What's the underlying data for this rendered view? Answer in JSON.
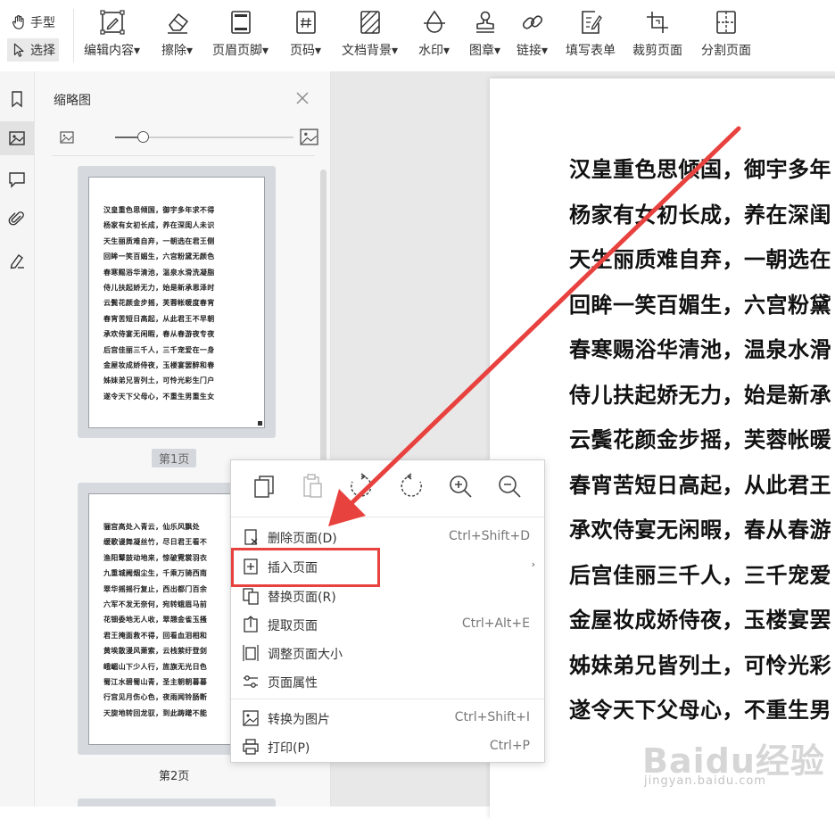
{
  "toolbar": {
    "hand_label": "手型",
    "select_label": "选择",
    "tools": [
      {
        "label": "编辑内容",
        "icon": "edit-content-icon"
      },
      {
        "label": "擦除",
        "icon": "eraser-icon"
      },
      {
        "label": "页眉页脚",
        "icon": "header-footer-icon"
      },
      {
        "label": "页码",
        "icon": "page-number-icon"
      },
      {
        "label": "文档背景",
        "icon": "document-background-icon"
      },
      {
        "label": "水印",
        "icon": "watermark-icon"
      },
      {
        "label": "图章",
        "icon": "stamp-icon"
      },
      {
        "label": "链接",
        "icon": "link-icon"
      },
      {
        "label": "填写表单",
        "icon": "fill-form-icon"
      },
      {
        "label": "裁剪页面",
        "icon": "crop-page-icon"
      },
      {
        "label": "分割页面",
        "icon": "split-page-icon"
      }
    ],
    "dropdown_marker": "▾"
  },
  "rail": {
    "icons": [
      "bookmark-icon",
      "thumbnail-icon",
      "comment-icon",
      "attachment-icon",
      "signature-icon"
    ],
    "active_index": 1
  },
  "thumbnails": {
    "title": "缩略图",
    "zoom_level": 0.16,
    "page1_label": "第1页",
    "page2_label": "第2页",
    "page1_lines": [
      "汉皇重色思倾国，御宇多年求不得",
      "杨家有女初长成，养在深闺人未识",
      "天生丽质难自弃，一朝选在君王侧",
      "回眸一笑百媚生，六宫粉黛无颜色",
      "春寒赐浴华清池，温泉水滑洗凝脂",
      "侍儿扶起娇无力，始是新承恩泽时",
      "云鬓花颜金步摇，芙蓉帐暖度春宵",
      "春宵苦短日高起，从此君王不早朝",
      "承欢侍宴无闲暇，春从春游夜专夜",
      "后宫佳丽三千人，三千宠爱在一身",
      "金屋妆成娇侍夜，玉楼宴罢醉和春",
      "姊妹弟兄皆列土，可怜光彩生门户",
      "遂令天下父母心，不重生男重生女"
    ],
    "page2_lines": [
      "骊宫高处入青云，仙乐风飘处",
      "缓歌谩舞凝丝竹，尽日君王看不",
      "渔阳鼙鼓动地来，惊破霓裳羽衣",
      "九重城阙烟尘生，千乘万骑西南",
      "翠华摇摇行复止，西出都门百余",
      "六军不发无奈何，宛转蛾眉马前",
      "花钿委地无人收，翠翘金雀玉搔",
      "君王掩面救不得，回看血泪相和",
      "黄埃散漫风萧索，云栈萦纡登剑",
      "峨嵋山下少人行，旌旗无光日色",
      "蜀江水碧蜀山青，圣主朝朝暮暮",
      "行宫见月伤心色，夜雨闻铃肠断",
      "天旋地转回龙驭，到此踌躇不能"
    ]
  },
  "document": {
    "lines": [
      "汉皇重色思倾国，御宇多年",
      "杨家有女初长成，养在深闺",
      "天生丽质难自弃，一朝选在",
      "回眸一笑百媚生，六宫粉黛",
      "春寒赐浴华清池，温泉水滑",
      "侍儿扶起娇无力，始是新承",
      "云鬓花颜金步摇，芙蓉帐暖",
      "春宵苦短日高起，从此君王",
      "承欢侍宴无闲暇，春从春游",
      "后宫佳丽三千人，三千宠爱",
      "金屋妆成娇侍夜，玉楼宴罢",
      "姊妹弟兄皆列土，可怜光彩",
      "遂令天下父母心，不重生男"
    ]
  },
  "context_menu": {
    "icon_actions": [
      "copy-page-icon",
      "paste-page-icon",
      "rotate-right-icon",
      "rotate-left-icon",
      "zoom-in-icon",
      "zoom-out-icon"
    ],
    "items": [
      {
        "label": "删除页面(D)",
        "shortcut": "Ctrl+Shift+D",
        "icon": "delete-page-icon"
      },
      {
        "label": "插入页面",
        "shortcut": "",
        "icon": "insert-page-icon",
        "submenu": "›"
      },
      {
        "label": "替换页面(R)",
        "shortcut": "",
        "icon": "replace-page-icon"
      },
      {
        "label": "提取页面",
        "shortcut": "Ctrl+Alt+E",
        "icon": "extract-page-icon"
      },
      {
        "label": "调整页面大小",
        "shortcut": "",
        "icon": "resize-page-icon"
      },
      {
        "label": "页面属性",
        "shortcut": "",
        "icon": "page-properties-icon"
      },
      {
        "label": "转换为图片",
        "shortcut": "Ctrl+Shift+I",
        "icon": "convert-to-image-icon"
      },
      {
        "label": "打印(P)",
        "shortcut": "Ctrl+P",
        "icon": "print-icon"
      }
    ]
  },
  "annotation": {
    "color": "#e8423f",
    "highlighted_item": "插入页面"
  },
  "watermark": {
    "brand": "Baidu经验",
    "url": "jingyan.baidu.com"
  }
}
